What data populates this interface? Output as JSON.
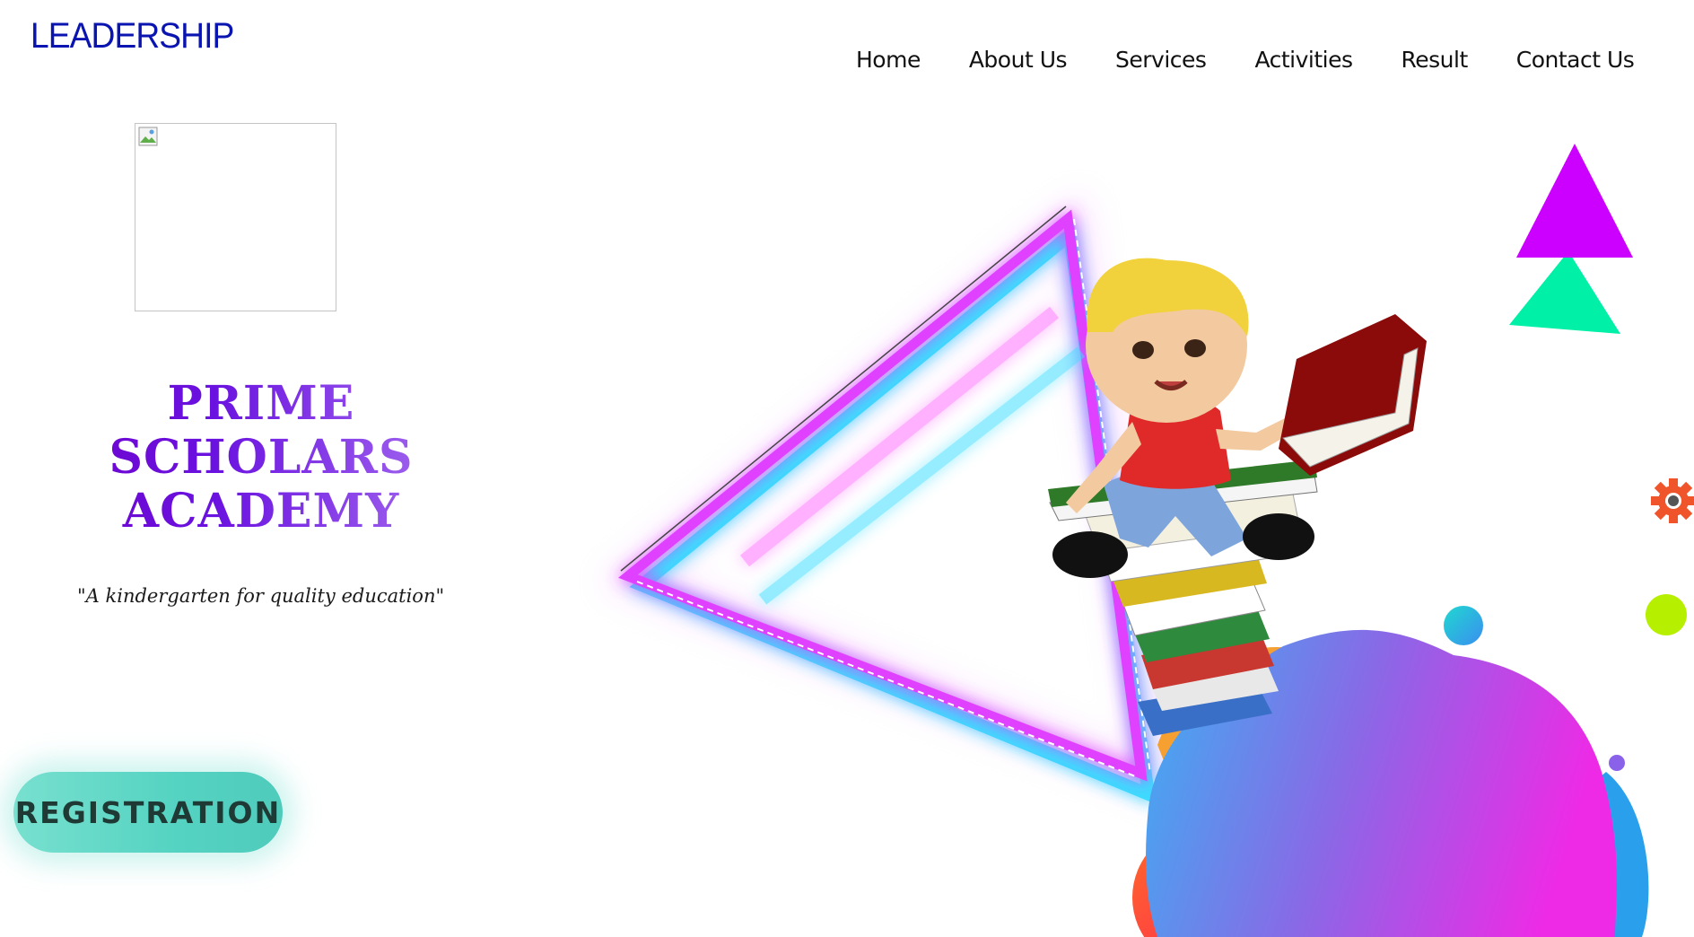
{
  "header": {
    "brand": "LEADERSHIP",
    "nav": [
      "Home",
      "About Us",
      "Services",
      "Activities",
      "Result",
      "Contact Us"
    ]
  },
  "hero": {
    "school_name_line1": "PRIME SCHOLARS",
    "school_name_line2": "ACADEMY",
    "tagline": "\"A kindergarten for quality education\"",
    "registration_label": "REGISTRATION"
  },
  "colors": {
    "brand": "#0a14b0",
    "title_gradient_start": "#7000c8",
    "title_gradient_end": "#b07cf2",
    "registration_button": "#5fd6c4",
    "triangle_purple": "#cc00ff",
    "triangle_green": "#00f0a8"
  },
  "icons": {
    "logo_placeholder": "broken-image-icon",
    "side_widget": "gear-icon"
  }
}
